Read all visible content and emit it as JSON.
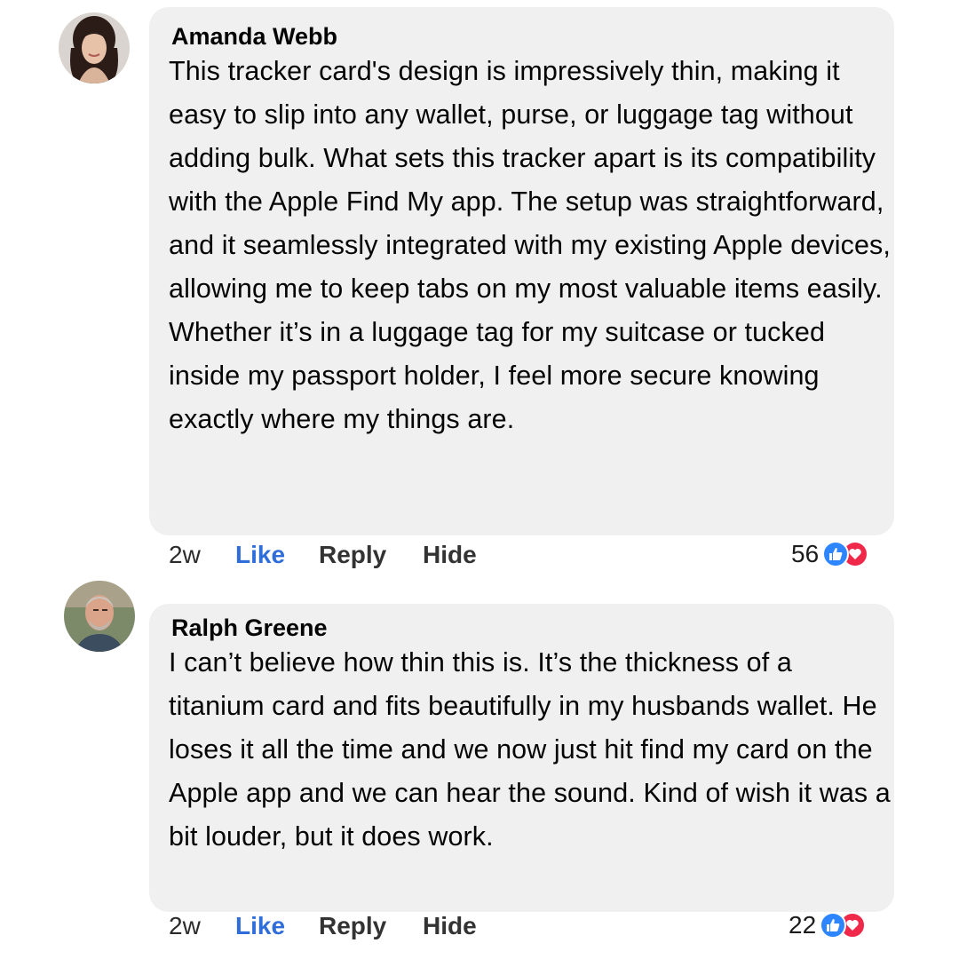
{
  "comments": [
    {
      "author": "Amanda Webb",
      "text": "This tracker card's design is impressively thin, making it easy to slip into any wallet, purse, or luggage tag without adding bulk. What sets this tracker apart is its compatibility with the Apple Find My app. The setup was straightforward, and it seamlessly integrated with my existing Apple devices, allowing me to keep tabs on my most valuable items easily. Whether it’s in a luggage tag for my suitcase or tucked inside my passport holder, I feel more secure knowing exactly where my things are.",
      "time": "2w",
      "like_label": "Like",
      "reply_label": "Reply",
      "hide_label": "Hide",
      "reaction_count": "56",
      "reaction_icons": [
        "like-icon",
        "love-icon"
      ]
    },
    {
      "author": "Ralph Greene",
      "text": "I can’t believe how thin this is. It’s the thickness of a titanium card and fits beautifully in my husbands wallet. He loses it all the time and we now just hit find my card on the Apple app and we can hear the sound. Kind of wish it was a bit louder, but it does work.",
      "time": "2w",
      "like_label": "Like",
      "reply_label": "Reply",
      "hide_label": "Hide",
      "reaction_count": "22",
      "reaction_icons": [
        "like-icon",
        "love-icon"
      ]
    }
  ],
  "colors": {
    "bubble": "#f0f0f0",
    "like_action": "#2f6ddb",
    "like_reaction": "#2d86ff",
    "love_reaction": "#f0284a"
  }
}
